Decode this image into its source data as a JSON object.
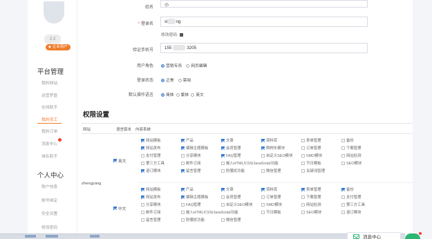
{
  "sidebar": {
    "username": "2  2",
    "badge": "企业用户",
    "platform_title": "平台管理",
    "platform_items": [
      "我的网站",
      "运营罗盘",
      "在线助手",
      "我的员工",
      "我的订单",
      "消息中心",
      "域名助手"
    ],
    "active_item": "我的员工",
    "personal_title": "个人中心",
    "personal_items": [
      "账户信息",
      "账号绑定",
      "安全设置",
      "修改密码"
    ]
  },
  "form": {
    "top_label": "姓名",
    "top_value": "小",
    "login_label": "登录名",
    "login_value_prefix": "xi",
    "login_value_suffix": "ng",
    "modify_password": "修改密码",
    "phone_label": "验证手机号",
    "phone_prefix": "155",
    "phone_suffix": "3205",
    "role_label": "用户角色",
    "role_options": [
      "营销专员",
      "网页编辑"
    ],
    "status_label": "登录状态",
    "status_options": [
      "正常",
      "禁用"
    ],
    "lang_label": "默认操作语言",
    "lang_options": [
      "简体",
      "繁体",
      "英文"
    ]
  },
  "permissions": {
    "title": "权限设置",
    "headers": [
      "网站",
      "语言版本",
      "内容系统"
    ],
    "user": "zhengyang",
    "groups": [
      {
        "lang": "英文",
        "rows": [
          [
            [
              "网站模板",
              true
            ],
            [
              "产品",
              true
            ],
            [
              "文章",
              true
            ],
            [
              "资料库",
              true
            ],
            [
              "表单管理",
              false
            ],
            [
              "备份",
              false
            ]
          ],
          [
            [
              "网站发布",
              true
            ],
            [
              "编辑主题模板",
              true
            ],
            [
              "会员管理",
              true
            ],
            [
              "购物车模块",
              true
            ],
            [
              "订单管理",
              false
            ],
            [
              "下载管理",
              false
            ]
          ],
          [
            [
              "支付管理",
              false
            ],
            [
              "分享模块",
              false
            ],
            [
              "FAQ管理",
              true
            ],
            [
              "自定义SEO模块",
              false
            ],
            [
              "SMO模块",
              false
            ],
            [
              "网站检测",
              false
            ]
          ],
          [
            [
              "第三方工具",
              false
            ],
            [
              "邮件订阅",
              false
            ],
            [
              "嵌入HTML/CSS/JavaScript功能",
              false,
              2
            ],
            [
              "节日模板",
              false
            ],
            [
              "SEO模块",
              false
            ]
          ],
          [
            [
              "退订模块",
              true
            ],
            [
              "留言管理",
              true
            ],
            [
              "防骚扰功能",
              false
            ],
            [
              "微信管理",
              false
            ],
            [
              "关键词管理",
              false
            ]
          ]
        ]
      },
      {
        "lang": "中文",
        "rows": [
          [
            [
              "网站模板",
              true
            ],
            [
              "产品",
              true
            ],
            [
              "文章",
              true
            ],
            [
              "资料库",
              true
            ],
            [
              "表单管理",
              true
            ],
            [
              "备份",
              true
            ]
          ],
          [
            [
              "网站发布",
              true
            ],
            [
              "编辑主题模板",
              true
            ],
            [
              "会员管理",
              false
            ],
            [
              "订单管理",
              false
            ],
            [
              "下载管理",
              false
            ],
            [
              "支付管理",
              false
            ]
          ],
          [
            [
              "分享模块",
              false
            ],
            [
              "FAQ管理",
              false
            ],
            [
              "自定义SEO模块",
              false
            ],
            [
              "SMO模块",
              false
            ],
            [
              "网站检测",
              false
            ],
            [
              "第三方工具",
              false
            ]
          ],
          [
            [
              "邮件订阅",
              false
            ],
            [
              "嵌入HTML/CSS/JavaScript功能",
              false,
              2
            ],
            [
              "节日模板",
              false
            ],
            [
              "SEO模块",
              false
            ],
            [
              "退订模块",
              false
            ]
          ],
          [
            [
              "留言管理",
              false
            ],
            [
              "防骚扰功能",
              false
            ],
            [
              "微信管理",
              false
            ]
          ]
        ]
      }
    ]
  },
  "footer": {
    "message_center": "消息中心"
  },
  "colors": {
    "accent": "#f07c2b",
    "checkbox": "#3a7bd5",
    "chat": "#2bb673"
  }
}
